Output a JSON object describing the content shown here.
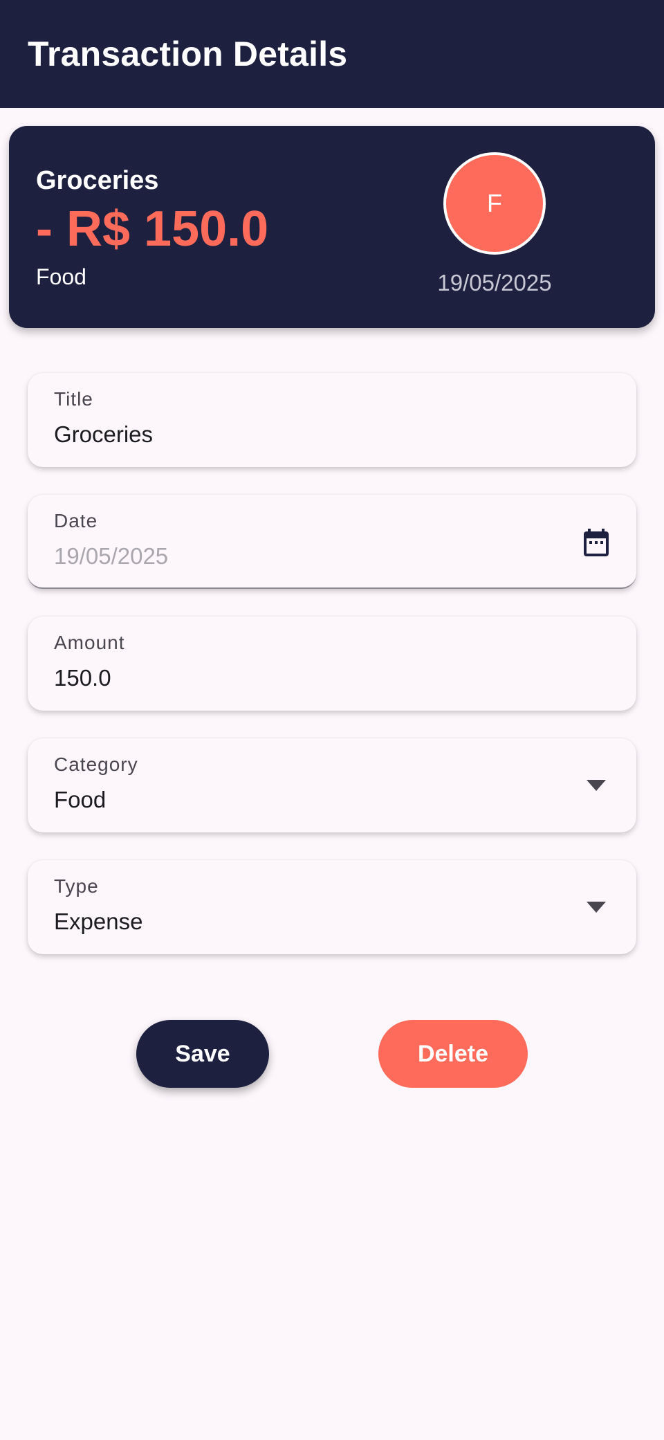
{
  "app_bar": {
    "title": "Transaction Details"
  },
  "summary": {
    "title": "Groceries",
    "amount": "- R$ 150.0",
    "category": "Food",
    "avatar_letter": "F",
    "date": "19/05/2025"
  },
  "form": {
    "title": {
      "label": "Title",
      "value": "Groceries"
    },
    "date": {
      "label": "Date",
      "value": "19/05/2025",
      "icon": "calendar-icon"
    },
    "amount": {
      "label": "Amount",
      "value": "150.0"
    },
    "category": {
      "label": "Category",
      "value": "Food",
      "icon": "dropdown-arrow-icon"
    },
    "type": {
      "label": "Type",
      "value": "Expense",
      "icon": "dropdown-arrow-icon"
    }
  },
  "actions": {
    "save_label": "Save",
    "delete_label": "Delete"
  },
  "colors": {
    "primary": "#1e2040",
    "accent": "#ff6b5b",
    "background": "#fdf7fc"
  }
}
